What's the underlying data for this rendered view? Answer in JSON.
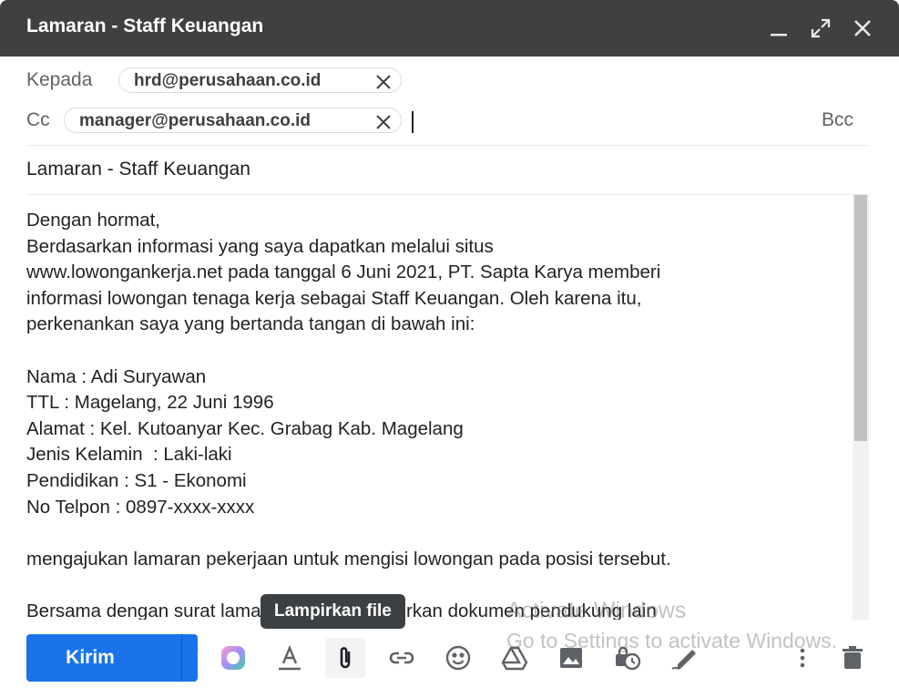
{
  "window": {
    "title": "Lamaran - Staff Keuangan"
  },
  "recipients": {
    "to_label": "Kepada",
    "to_chip": "hrd@perusahaan.co.id",
    "cc_label": "Cc",
    "cc_chip": "manager@perusahaan.co.id",
    "bcc_label": "Bcc"
  },
  "subject": "Lamaran - Staff Keuangan",
  "body_lines": [
    "Dengan hormat,",
    "Berdasarkan informasi yang saya dapatkan melalui situs",
    "www.lowongankerja.net pada tanggal 6 Juni 2021, PT. Sapta Karya memberi",
    "informasi lowongan tenaga kerja sebagai Staff Keuangan. Oleh karena itu,",
    "perkenankan saya yang bertanda tangan di bawah ini:",
    "",
    "Nama : Adi Suryawan",
    "TTL : Magelang, 22 Juni 1996",
    "Alamat : Kel. Kutoanyar Kec. Grabag Kab. Magelang",
    "Jenis Kelamin  : Laki-laki",
    "Pendidikan : S1 - Ekonomi",
    "No Telpon : 0897-xxxx-xxxx",
    "",
    "mengajukan lamaran pekerjaan untuk mengisi lowongan pada posisi tersebut.",
    "",
    "Bersama dengan surat lamaran ini saya lampirkan dokumen pendukung lain"
  ],
  "tooltip": "Lampirkan file",
  "toolbar": {
    "send_label": "Kirim",
    "icons": [
      "formatting-options-icon",
      "text-format-icon",
      "attach-file-icon",
      "insert-link-icon",
      "emoji-icon",
      "drive-icon",
      "insert-photo-icon",
      "confidential-mode-icon",
      "signature-icon",
      "more-options-icon",
      "discard-draft-icon"
    ]
  },
  "watermark": {
    "line1": "Activate Windows",
    "line2": "Go to Settings to activate Windows."
  },
  "colors": {
    "titlebar": "#404040",
    "send": "#1a73e8",
    "tooltip": "#3c4043"
  }
}
